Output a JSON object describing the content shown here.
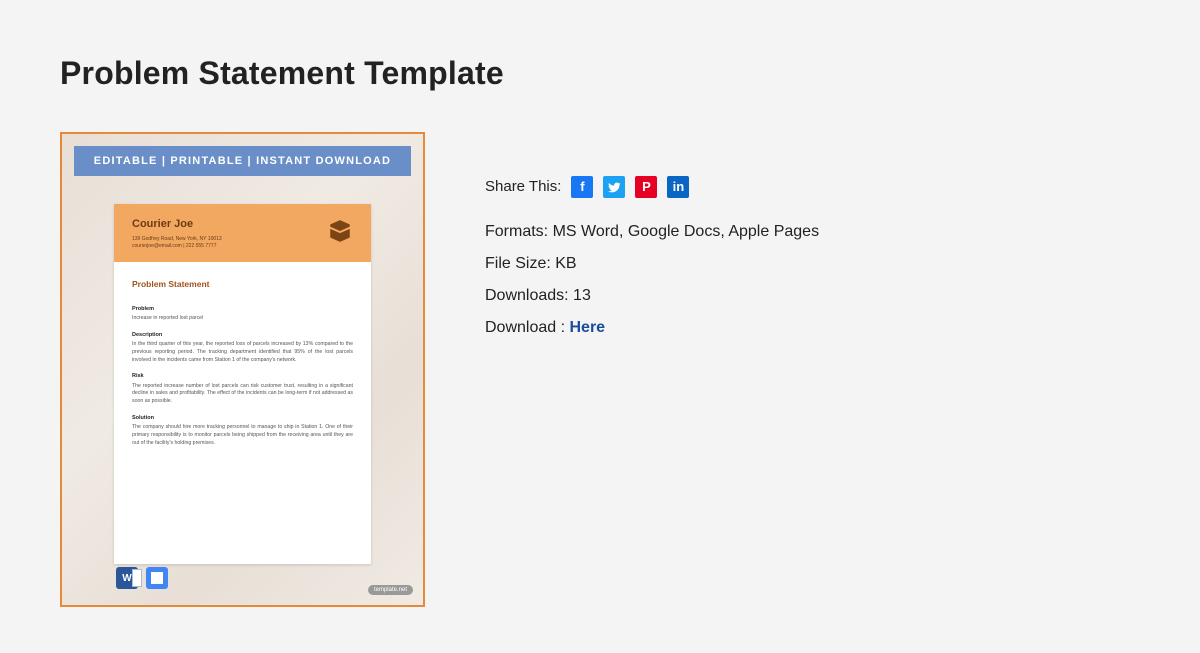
{
  "page_title": "Problem Statement Template",
  "preview": {
    "banner": "EDITABLE  |  PRINTABLE  |  INSTANT DOWNLOAD",
    "brand_name": "Courier Joe",
    "brand_address_line1": "139 Godfrey Road, New York, NY 10013",
    "brand_address_line2": "courierjoe@email.com | 222 555 7777",
    "ps_title": "Problem Statement",
    "sec_problem_label": "Problem",
    "sec_problem_text": "Increase in reported lost parcel",
    "sec_description_label": "Description",
    "sec_description_text": "In the third quarter of this year, the reported loss of parcels increased by 13% compared to the previous reporting period. The tracking department identified that 95% of the lost parcels involved in the incidents came from Station 1 of the company's network.",
    "sec_risk_label": "Risk",
    "sec_risk_text": "The reported increase number of lost parcels can risk customer trust, resulting in a significant decline in sales and profitability. The effect of the incidents can be long-term if not addressed as soon as possible.",
    "sec_solution_label": "Solution",
    "sec_solution_text": "The company should hire more tracking personnel to manage to ship in Station 1. One of their primary responsibility is to monitor parcels being shipped from the receiving area until they are out of the facility's holding premises.",
    "word_glyph": "W",
    "template_tag": "template.net"
  },
  "share": {
    "label": "Share This:",
    "fb": "f",
    "pn": "P",
    "li": "in"
  },
  "meta": {
    "formats_label": "Formats: ",
    "formats_value": "MS Word, Google Docs, Apple Pages",
    "filesize_label": "File Size: ",
    "filesize_value": "KB",
    "downloads_label": "Downloads: ",
    "downloads_value": "13",
    "download_label": "Download : ",
    "download_link": "Here"
  }
}
